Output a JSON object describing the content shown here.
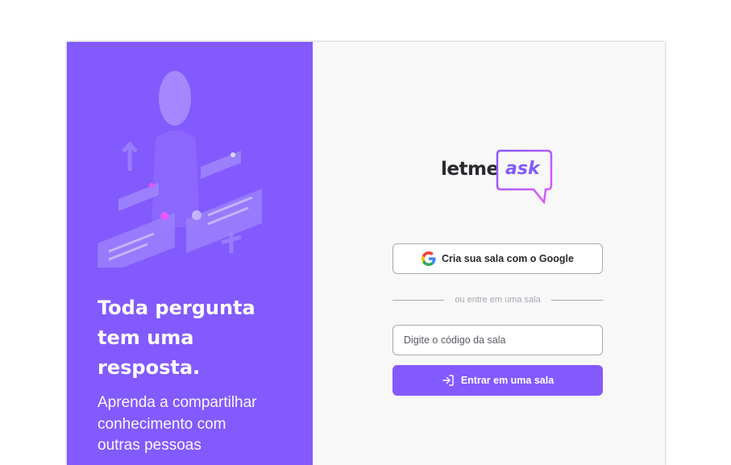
{
  "aside": {
    "headline": "Toda pergunta tem uma resposta.",
    "subtext": "Aprenda a compartilhar conhecimento com outras pessoas"
  },
  "logo": {
    "part1": "letme",
    "part2": "ask",
    "icon": "speech-bubble-icon"
  },
  "main": {
    "google_button_label": "Cria sua sala com o Google",
    "google_icon": "google-icon",
    "separator_text": "ou entre em uma sala",
    "room_code_placeholder": "Digite o código da sala",
    "room_code_value": "",
    "enter_button_label": "Entrar em uma sala",
    "enter_icon": "log-in-icon"
  },
  "colors": {
    "brand": "#835afd",
    "aside_background": "#835afd",
    "main_background": "#f8f8f8",
    "text_dark": "#29292e",
    "border_gray": "#a8a8b3",
    "logo_gradient_start": "#835afd",
    "logo_gradient_end": "#e559f9"
  }
}
